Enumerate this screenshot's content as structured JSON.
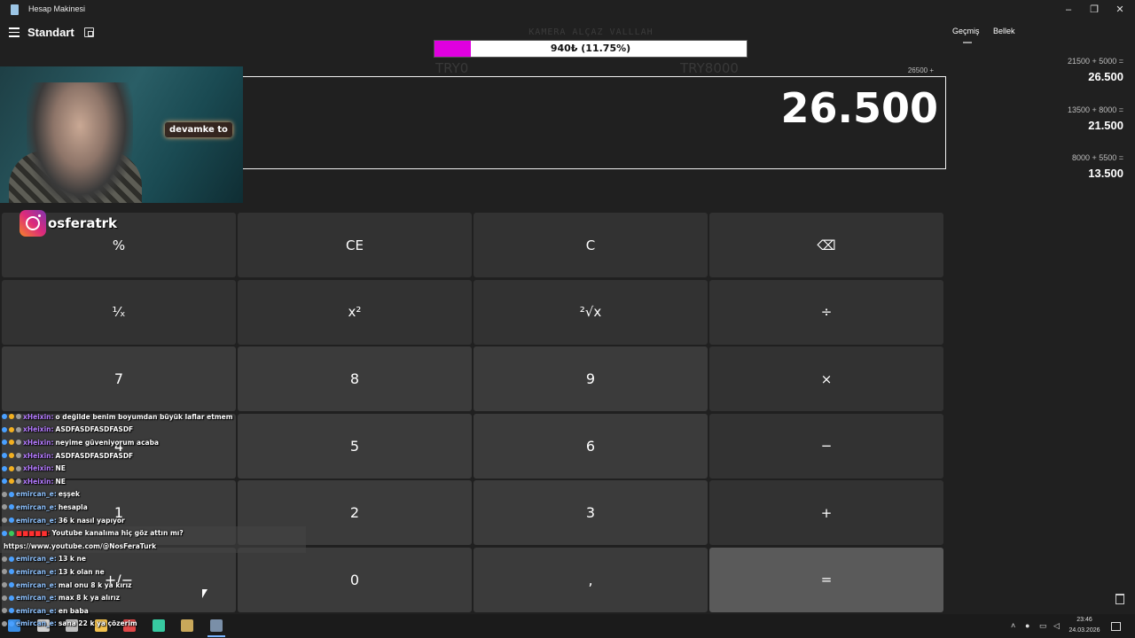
{
  "window": {
    "title": "Hesap Makinesi",
    "controls": {
      "minimize": "–",
      "maximize": "❐",
      "close": "✕"
    }
  },
  "header": {
    "mode": "Standart"
  },
  "overlay": {
    "caption": "KAMERA ALÇAZ VALLLAH",
    "goal_text": "940₺ (11.75%)",
    "goal_progress": 0.1175,
    "goal_min": "TRY0",
    "goal_max": "TRY8000",
    "instagram": "osferatrk",
    "cam_sign": "devamke to"
  },
  "display": {
    "expression": "26500 +",
    "value": "26.500"
  },
  "keys": [
    {
      "label": "%",
      "kind": "fn",
      "name": "percent-button"
    },
    {
      "label": "CE",
      "kind": "fn",
      "name": "clear-entry-button"
    },
    {
      "label": "C",
      "kind": "fn",
      "name": "clear-button"
    },
    {
      "label": "⌫",
      "kind": "fn",
      "name": "backspace-button"
    },
    {
      "label": "¹⁄ₓ",
      "kind": "fn",
      "name": "reciprocal-button"
    },
    {
      "label": "x²",
      "kind": "fn",
      "name": "square-button"
    },
    {
      "label": "²√x",
      "kind": "fn",
      "name": "square-root-button"
    },
    {
      "label": "÷",
      "kind": "fn",
      "name": "divide-button"
    },
    {
      "label": "7",
      "kind": "num",
      "name": "digit-7-button"
    },
    {
      "label": "8",
      "kind": "num",
      "name": "digit-8-button"
    },
    {
      "label": "9",
      "kind": "num",
      "name": "digit-9-button"
    },
    {
      "label": "×",
      "kind": "fn",
      "name": "multiply-button"
    },
    {
      "label": "4",
      "kind": "num",
      "name": "digit-4-button"
    },
    {
      "label": "5",
      "kind": "num",
      "name": "digit-5-button"
    },
    {
      "label": "6",
      "kind": "num",
      "name": "digit-6-button"
    },
    {
      "label": "−",
      "kind": "fn",
      "name": "subtract-button"
    },
    {
      "label": "1",
      "kind": "num",
      "name": "digit-1-button"
    },
    {
      "label": "2",
      "kind": "num",
      "name": "digit-2-button"
    },
    {
      "label": "3",
      "kind": "num",
      "name": "digit-3-button"
    },
    {
      "label": "+",
      "kind": "fn",
      "name": "add-button"
    },
    {
      "label": "+/−",
      "kind": "num",
      "name": "negate-button"
    },
    {
      "label": "0",
      "kind": "num",
      "name": "digit-0-button"
    },
    {
      "label": ",",
      "kind": "num",
      "name": "decimal-button"
    },
    {
      "label": "=",
      "kind": "eq",
      "name": "equals-button"
    }
  ],
  "history": {
    "tabs": [
      "Geçmiş",
      "Bellek"
    ],
    "items": [
      {
        "expr": "21500  +  5000 =",
        "result": "26.500"
      },
      {
        "expr": "13500  +  8000 =",
        "result": "21.500"
      },
      {
        "expr": "8000  +  5500 =",
        "result": "13.500"
      }
    ]
  },
  "chat": [
    {
      "user": "xHeixin",
      "color": "purple",
      "badges": [
        "blue",
        "gold",
        "gray"
      ],
      "msg": "o değilde benim boyumdan büyük laflar etmem"
    },
    {
      "user": "xHeixin",
      "color": "purple",
      "badges": [
        "blue",
        "gold",
        "gray"
      ],
      "msg": "ASDFASDFASDFASDF"
    },
    {
      "user": "xHeixin",
      "color": "purple",
      "badges": [
        "blue",
        "gold",
        "gray"
      ],
      "msg": "neyime güveniyorum acaba"
    },
    {
      "user": "xHeixin",
      "color": "purple",
      "badges": [
        "blue",
        "gold",
        "gray"
      ],
      "msg": "ASDFASDFASDFASDF"
    },
    {
      "user": "xHeixin",
      "color": "purple",
      "badges": [
        "blue",
        "gold",
        "gray"
      ],
      "msg": "NE"
    },
    {
      "user": "xHeixin",
      "color": "purple",
      "badges": [
        "blue",
        "gold",
        "gray"
      ],
      "msg": "NE"
    },
    {
      "user": "emircan_e",
      "color": "blue",
      "badges": [
        "gray",
        "blue"
      ],
      "msg": "eşşek"
    },
    {
      "user": "emircan_e",
      "color": "blue",
      "badges": [
        "gray",
        "blue"
      ],
      "msg": "hesapla"
    },
    {
      "user": "emircan_e",
      "color": "blue",
      "badges": [
        "gray",
        "blue"
      ],
      "msg": "36 k nasıl yapıyor"
    },
    {
      "user": "",
      "color": "red",
      "badges": [
        "blue",
        "green"
      ],
      "msg": "Youtube kanalıma hiç göz attın mı?",
      "highlight": true
    },
    {
      "user": "",
      "color": "",
      "badges": [],
      "msg": "https://www.youtube.com/@NosFeraTurk",
      "highlight": true,
      "link": true
    },
    {
      "user": "emircan_e",
      "color": "blue",
      "badges": [
        "gray",
        "blue"
      ],
      "msg": "13 k ne"
    },
    {
      "user": "emircan_e",
      "color": "blue",
      "badges": [
        "gray",
        "blue"
      ],
      "msg": "13 k olan ne"
    },
    {
      "user": "emircan_e",
      "color": "blue",
      "badges": [
        "gray",
        "blue"
      ],
      "msg": "mal onu 8 k ya kırız"
    },
    {
      "user": "emircan_e",
      "color": "blue",
      "badges": [
        "gray",
        "blue"
      ],
      "msg": "max 8 k ya alırız"
    },
    {
      "user": "emircan_e",
      "color": "blue",
      "badges": [
        "gray",
        "blue"
      ],
      "msg": "en baba"
    },
    {
      "user": "emircan_e",
      "color": "blue",
      "badges": [
        "gray",
        "blue"
      ],
      "msg": "sana 22 k ya çözerim"
    }
  ],
  "taskbar": {
    "time": "23:46",
    "date": "24.03.2026",
    "apps": [
      {
        "name": "start-icon",
        "color": "#3a8ee6"
      },
      {
        "name": "search-icon",
        "color": "#cfcfcf"
      },
      {
        "name": "task-view-icon",
        "color": "#bdbdbd"
      },
      {
        "name": "file-explorer-icon",
        "color": "#f2c14e"
      },
      {
        "name": "browser-icon",
        "color": "#e04848"
      },
      {
        "name": "chat-app-icon",
        "color": "#37c9a0"
      },
      {
        "name": "game-launcher-icon",
        "color": "#c9a85a"
      },
      {
        "name": "calculator-icon",
        "color": "#7a8fa8"
      }
    ]
  }
}
